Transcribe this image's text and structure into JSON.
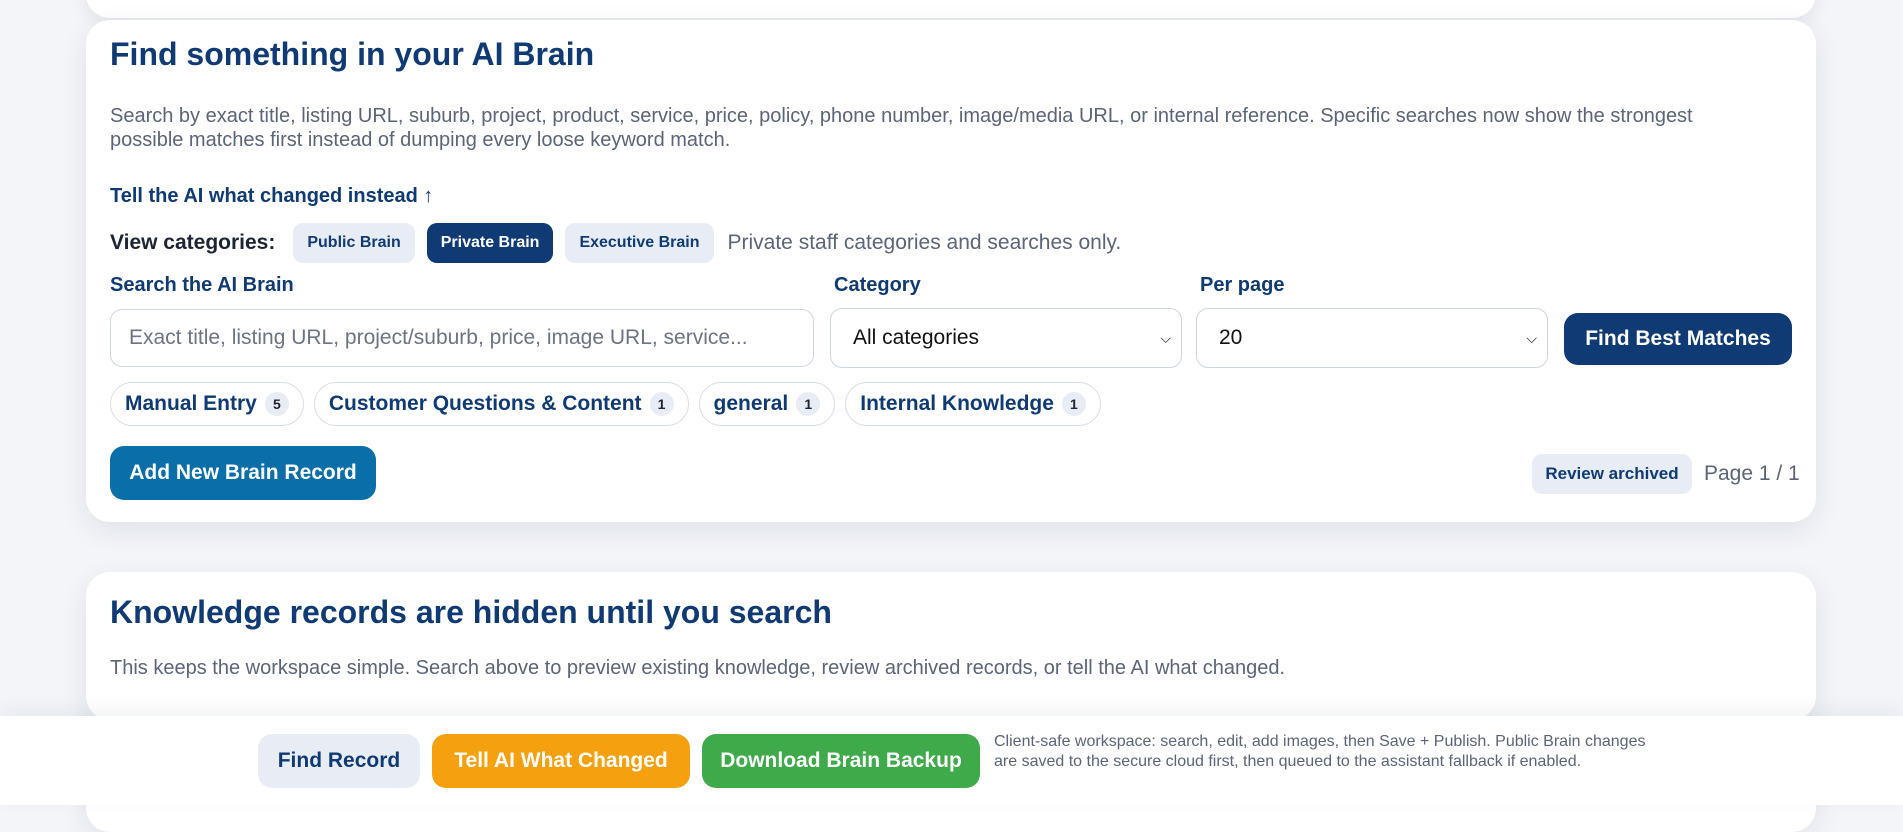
{
  "search_panel": {
    "title": "Find something in your AI Brain",
    "description": "Search by exact title, listing URL, suburb, project, product, service, price, policy, phone number, image/media URL, or internal reference. Specific searches now show the strongest possible matches first instead of dumping every loose keyword match.",
    "tell_ai_link": "Tell the AI what changed instead ↑",
    "view_label": "View categories:",
    "views": [
      {
        "label": "Public Brain",
        "active": false
      },
      {
        "label": "Private Brain",
        "active": true
      },
      {
        "label": "Executive Brain",
        "active": false
      }
    ],
    "view_hint": "Private staff categories and searches only.",
    "search_label": "Search the AI Brain",
    "search_placeholder": "Exact title, listing URL, project/suburb, price, image URL, service...",
    "search_value": "",
    "category_label": "Category",
    "category_selected": "All categories",
    "per_page_label": "Per page",
    "per_page_selected": "20",
    "find_button": "Find Best Matches",
    "chips": [
      {
        "label": "Manual Entry",
        "count": "5"
      },
      {
        "label": "Customer Questions & Content",
        "count": "1"
      },
      {
        "label": "general",
        "count": "1"
      },
      {
        "label": "Internal Knowledge",
        "count": "1"
      }
    ],
    "add_button": "Add New Brain Record",
    "review_archived": "Review archived",
    "page_indicator": "Page 1 / 1"
  },
  "empty_state": {
    "title": "Knowledge records are hidden until you search",
    "description": "This keeps the workspace simple. Search above to preview existing knowledge, review archived records, or tell the AI what changed."
  },
  "bottom_bar": {
    "find_record": "Find Record",
    "tell_ai": "Tell AI What Changed",
    "download_backup": "Download Brain Backup",
    "note": "Client-safe workspace: search, edit, add images, then Save + Publish. Public Brain changes are saved to the secure cloud first, then queued to the assistant fallback if enabled."
  },
  "colors": {
    "primary": "#0f3a73",
    "accent_blue": "#0a6fa8",
    "orange": "#f5a00e",
    "green": "#3eaa4a",
    "muted_bg": "#e8ecf4"
  }
}
